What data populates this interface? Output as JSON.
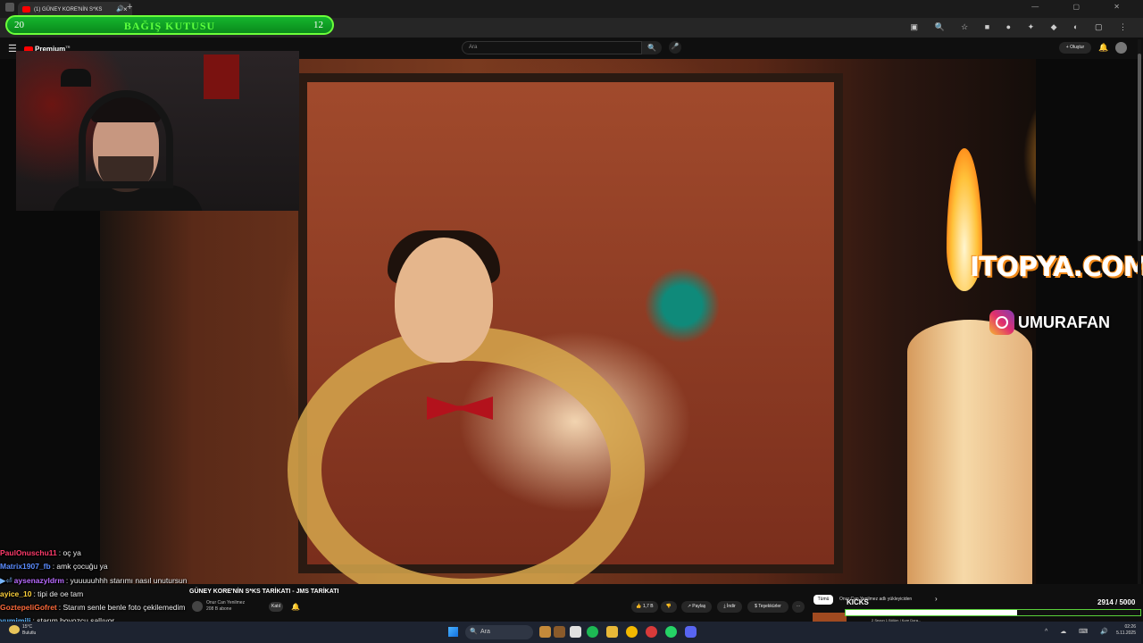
{
  "browser": {
    "tab_title": "(1) GÜNEY KORE'NİN S*KS",
    "new_tab": "+",
    "tab_close": "×",
    "tab_sound": "🔊",
    "window_controls": "— ▢ ✕"
  },
  "donation": {
    "left_value": "20",
    "title": "BAĞIŞ KUTUSU",
    "right_value": "12"
  },
  "youtube": {
    "menu_icon": "☰",
    "logo_label": "Premium",
    "logo_sup": "TR",
    "search_placeholder": "Ara",
    "search_icon": "🔍",
    "mic_icon": "🎤",
    "create_label": "+ Oluştur",
    "notification_icon": "🔔"
  },
  "overlays": {
    "sponsor": "ITOPYA.COM",
    "instagram_handle": "UMURAFAN"
  },
  "chat": [
    {
      "user": "PaulOnuschu11",
      "msg": ": oç ya",
      "color": "#ff3b6b"
    },
    {
      "user": "Matrix1907_fb",
      "msg": ": amk çocuğu ya",
      "color": "#5b8cff"
    },
    {
      "user": "aysenazyldrm",
      "msg": ": yuuuuuhhh starımı nasıl unutursun",
      "color": "#b96bff",
      "badge": "▶⏎"
    },
    {
      "user": "ayice_10",
      "msg": ": tipi de oe tam",
      "color": "#ffd23b"
    },
    {
      "user": "GoztepeliGofret",
      "msg": ": Starım senle benle foto çekilemedim",
      "color": "#ff6b3b"
    },
    {
      "user": "yumimili",
      "msg": ": starım boyozcu sallıyor",
      "color": "#5bb4ff"
    }
  ],
  "video_info": {
    "title": "GÜNEY KORE'NİN S*KS TARİKATI - JMS TARİKATI",
    "channel": "Onur Can Yenilmez",
    "subs": "208 B abone",
    "join_label": "Katıl",
    "bell_icon": "🔔",
    "likes": "👍 1,7 B",
    "dislike": "👎",
    "share": "↗ Paylaş",
    "download": "⤓ İndir",
    "thanks": "$ Teşekkürler",
    "more": "⋯"
  },
  "recommendations": {
    "chip_all": "Tümü",
    "chip_channel": "Onur Can Yenilmez adlı yükleyiciden",
    "next_icon": "›",
    "first_title": "2 Sezon 1 Bölüm | Kore Dora..."
  },
  "kicks_goal": {
    "label": "KICKS",
    "current": 2914,
    "target": 5000,
    "display": "2914 / 5000"
  },
  "taskbar": {
    "temperature": "15°C",
    "weather": "Bulutlu",
    "search_label": "Ara",
    "search_icon": "🔍",
    "tray": "^ ☁ ⌨ 🔊",
    "time": "02:26",
    "date": "5.11.2025"
  }
}
